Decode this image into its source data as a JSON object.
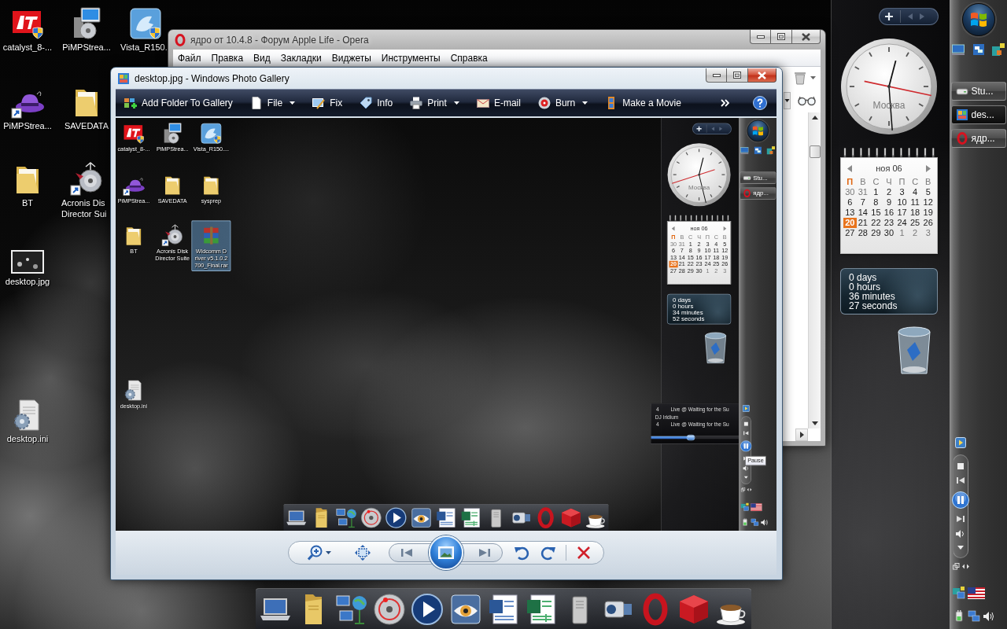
{
  "desktop": {
    "icons": [
      {
        "label": "catalyst_8-...",
        "kind": "ati",
        "selected": false
      },
      {
        "label": "PiMPStrea...",
        "kind": "installer",
        "selected": false
      },
      {
        "label": "Vista_R150.",
        "kind": "setup",
        "selected": false
      },
      {
        "label": "PiMPStrea...",
        "kind": "app",
        "selected": false
      },
      {
        "label": "SAVEDATA",
        "kind": "folder",
        "selected": false
      },
      {
        "label": "BT",
        "kind": "folder",
        "selected": false
      },
      {
        "label": "Acronis Dis\nDirector Sui",
        "kind": "shortcut",
        "selected": false
      },
      {
        "label": "desktop.jpg",
        "kind": "image",
        "selected": false
      },
      {
        "label": "desktop.ini",
        "kind": "config",
        "selected": false
      }
    ],
    "clock": {
      "city": "Москва"
    },
    "calendar": {
      "month": "ноя 06",
      "weekdays": [
        {
          "label": "П",
          "selected": true
        },
        {
          "label": "В",
          "selected": false
        },
        {
          "label": "С",
          "selected": false
        },
        {
          "label": "Ч",
          "selected": false
        },
        {
          "label": "П",
          "selected": false
        },
        {
          "label": "С",
          "selected": false
        },
        {
          "label": "В",
          "selected": false
        }
      ],
      "weeks": [
        [
          {
            "day": "30",
            "outside": true,
            "selected": false
          },
          {
            "day": "31",
            "outside": true,
            "selected": false
          },
          {
            "day": "1",
            "outside": false,
            "selected": false
          },
          {
            "day": "2",
            "outside": false,
            "selected": false
          },
          {
            "day": "3",
            "outside": false,
            "selected": false
          },
          {
            "day": "4",
            "outside": false,
            "selected": false
          },
          {
            "day": "5",
            "outside": false,
            "selected": false
          }
        ],
        [
          {
            "day": "6",
            "outside": false,
            "selected": false
          },
          {
            "day": "7",
            "outside": false,
            "selected": false
          },
          {
            "day": "8",
            "outside": false,
            "selected": false
          },
          {
            "day": "9",
            "outside": false,
            "selected": false
          },
          {
            "day": "10",
            "outside": false,
            "selected": false
          },
          {
            "day": "11",
            "outside": false,
            "selected": false
          },
          {
            "day": "12",
            "outside": false,
            "selected": false
          }
        ],
        [
          {
            "day": "13",
            "outside": false,
            "selected": false
          },
          {
            "day": "14",
            "outside": false,
            "selected": false
          },
          {
            "day": "15",
            "outside": false,
            "selected": false
          },
          {
            "day": "16",
            "outside": false,
            "selected": false
          },
          {
            "day": "17",
            "outside": false,
            "selected": false
          },
          {
            "day": "18",
            "outside": false,
            "selected": false
          },
          {
            "day": "19",
            "outside": false,
            "selected": false
          }
        ],
        [
          {
            "day": "20",
            "outside": false,
            "selected": true
          },
          {
            "day": "21",
            "outside": false,
            "selected": false
          },
          {
            "day": "22",
            "outside": false,
            "selected": false
          },
          {
            "day": "23",
            "outside": false,
            "selected": false
          },
          {
            "day": "24",
            "outside": false,
            "selected": false
          },
          {
            "day": "25",
            "outside": false,
            "selected": false
          },
          {
            "day": "26",
            "outside": false,
            "selected": false
          }
        ],
        [
          {
            "day": "27",
            "outside": false,
            "selected": false
          },
          {
            "day": "28",
            "outside": false,
            "selected": false
          },
          {
            "day": "29",
            "outside": false,
            "selected": false
          },
          {
            "day": "30",
            "outside": false,
            "selected": false
          },
          {
            "day": "1",
            "outside": true,
            "selected": false
          },
          {
            "day": "2",
            "outside": true,
            "selected": false
          },
          {
            "day": "3",
            "outside": true,
            "selected": false
          }
        ]
      ]
    },
    "uptime": [
      "0 days",
      "0 hours",
      "36 minutes",
      "27 seconds"
    ],
    "tasks": [
      {
        "label": "Stu...",
        "kind": "drive",
        "selected": false
      },
      {
        "label": "des...",
        "kind": "gallery",
        "selected": true
      },
      {
        "label": "ядр...",
        "kind": "browser",
        "selected": false
      }
    ]
  },
  "browser_window": {
    "title": "ядро от 10.4.8 - Форум Apple Life - Opera",
    "active": false,
    "menu": [
      "Файл",
      "Правка",
      "Вид",
      "Закладки",
      "Виджеты",
      "Инструменты",
      "Справка"
    ]
  },
  "gallery_window": {
    "title": "desktop.jpg - Windows Photo Gallery",
    "active": true,
    "toolbar": [
      {
        "label": "Add Folder To Gallery",
        "kind": "add-folder",
        "dropdown": false
      },
      {
        "label": "File",
        "kind": "file",
        "dropdown": true
      },
      {
        "label": "Fix",
        "kind": "fix",
        "dropdown": false
      },
      {
        "label": "Info",
        "kind": "info",
        "dropdown": false
      },
      {
        "label": "Print",
        "kind": "print",
        "dropdown": true
      },
      {
        "label": "E-mail",
        "kind": "email",
        "dropdown": false
      },
      {
        "label": "Burn",
        "kind": "burn",
        "dropdown": true
      },
      {
        "label": "Make a Movie",
        "kind": "movie",
        "dropdown": false
      }
    ],
    "photo": {
      "icons": [
        {
          "label": "catalyst_8-...",
          "kind": "ati",
          "selected": false
        },
        {
          "label": "PiMPStrea...",
          "kind": "installer",
          "selected": false
        },
        {
          "label": "Vista_R150....",
          "kind": "setup",
          "selected": false
        },
        {
          "label": "PiMPStrea...",
          "kind": "app",
          "selected": false
        },
        {
          "label": "SAVEDATA",
          "kind": "folder",
          "selected": false
        },
        {
          "label": "sysprep",
          "kind": "folder",
          "selected": false
        },
        {
          "label": "BT",
          "kind": "folder",
          "selected": false
        },
        {
          "label": "Acronis Disk\nDirector Suite",
          "kind": "shortcut",
          "selected": false
        },
        {
          "label": "Widcomm D\nriver v5.1.0.2\n700_Final.rar",
          "kind": "archive",
          "selected": true
        },
        {
          "label": "desktop.ini",
          "kind": "config",
          "selected": false
        }
      ],
      "clock": {
        "city": "Москва"
      },
      "calendar": {
        "month": "ноя 06",
        "weekdays": [
          {
            "label": "П",
            "selected": true
          },
          {
            "label": "В",
            "selected": false
          },
          {
            "label": "С",
            "selected": false
          },
          {
            "label": "Ч",
            "selected": false
          },
          {
            "label": "П",
            "selected": false
          },
          {
            "label": "С",
            "selected": false
          },
          {
            "label": "В",
            "selected": false
          }
        ],
        "weeks": [
          [
            {
              "day": "30",
              "outside": true,
              "selected": false
            },
            {
              "day": "31",
              "outside": true,
              "selected": false
            },
            {
              "day": "1",
              "outside": false,
              "selected": false
            },
            {
              "day": "2",
              "outside": false,
              "selected": false
            },
            {
              "day": "3",
              "outside": false,
              "selected": false
            },
            {
              "day": "4",
              "outside": false,
              "selected": false
            },
            {
              "day": "5",
              "outside": false,
              "selected": false
            }
          ],
          [
            {
              "day": "6",
              "outside": false,
              "selected": false
            },
            {
              "day": "7",
              "outside": false,
              "selected": false
            },
            {
              "day": "8",
              "outside": false,
              "selected": false
            },
            {
              "day": "9",
              "outside": false,
              "selected": false
            },
            {
              "day": "10",
              "outside": false,
              "selected": false
            },
            {
              "day": "11",
              "outside": false,
              "selected": false
            },
            {
              "day": "12",
              "outside": false,
              "selected": false
            }
          ],
          [
            {
              "day": "13",
              "outside": false,
              "selected": false
            },
            {
              "day": "14",
              "outside": false,
              "selected": false
            },
            {
              "day": "15",
              "outside": false,
              "selected": false
            },
            {
              "day": "16",
              "outside": false,
              "selected": false
            },
            {
              "day": "17",
              "outside": false,
              "selected": false
            },
            {
              "day": "18",
              "outside": false,
              "selected": false
            },
            {
              "day": "19",
              "outside": false,
              "selected": false
            }
          ],
          [
            {
              "day": "20",
              "outside": false,
              "selected": true
            },
            {
              "day": "21",
              "outside": false,
              "selected": false
            },
            {
              "day": "22",
              "outside": false,
              "selected": false
            },
            {
              "day": "23",
              "outside": false,
              "selected": false
            },
            {
              "day": "24",
              "outside": false,
              "selected": false
            },
            {
              "day": "25",
              "outside": false,
              "selected": false
            },
            {
              "day": "26",
              "outside": false,
              "selected": false
            }
          ],
          [
            {
              "day": "27",
              "outside": false,
              "selected": false
            },
            {
              "day": "28",
              "outside": false,
              "selected": false
            },
            {
              "day": "29",
              "outside": false,
              "selected": false
            },
            {
              "day": "30",
              "outside": false,
              "selected": false
            },
            {
              "day": "1",
              "outside": true,
              "selected": false
            },
            {
              "day": "2",
              "outside": true,
              "selected": false
            },
            {
              "day": "3",
              "outside": true,
              "selected": false
            }
          ]
        ]
      },
      "uptime": [
        "0 days",
        "0 hours",
        "34 minutes",
        "52 seconds"
      ],
      "tasks": [
        {
          "label": "Stu...",
          "kind": "drive",
          "selected": false
        },
        {
          "label": "ядр...",
          "kind": "browser",
          "selected": false
        }
      ],
      "media_widget": {
        "lines": [
          {
            "kind": "track",
            "number": "4",
            "text": "Live @ Waiting for the Su"
          },
          {
            "kind": "artist",
            "text": "DJ Iridium"
          },
          {
            "kind": "track",
            "number": "4",
            "text": "Live @ Waiting for the Su"
          }
        ],
        "level": 0.45
      },
      "tooltip": "Pause"
    }
  }
}
